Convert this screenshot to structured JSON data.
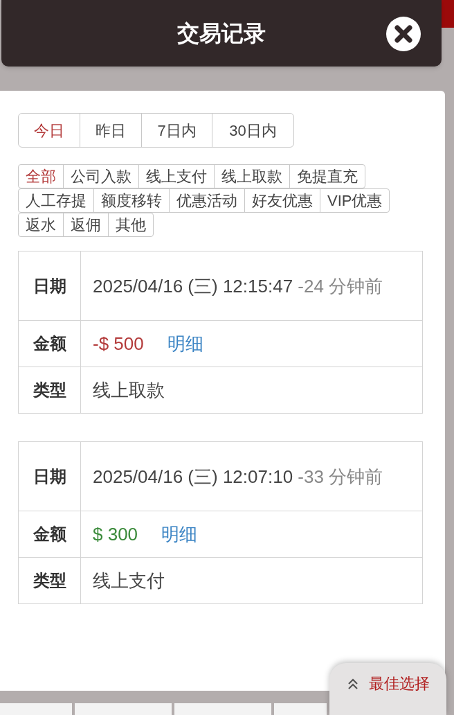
{
  "window": {
    "title": "交易记录"
  },
  "periods": [
    {
      "label": "今日",
      "selected": true
    },
    {
      "label": "昨日",
      "selected": false
    },
    {
      "label": "7日内",
      "selected": false
    },
    {
      "label": "30日内",
      "selected": false
    }
  ],
  "categories": [
    [
      {
        "label": "全部",
        "selected": true
      },
      {
        "label": "公司入款",
        "selected": false
      },
      {
        "label": "线上支付",
        "selected": false
      },
      {
        "label": "线上取款",
        "selected": false
      },
      {
        "label": "免提直充",
        "selected": false
      }
    ],
    [
      {
        "label": "人工存提",
        "selected": false
      },
      {
        "label": "额度移转",
        "selected": false
      },
      {
        "label": "优惠活动",
        "selected": false
      },
      {
        "label": "好友优惠",
        "selected": false
      },
      {
        "label": "VIP优惠",
        "selected": false
      }
    ],
    [
      {
        "label": "返水",
        "selected": false
      },
      {
        "label": "返佣",
        "selected": false
      },
      {
        "label": "其他",
        "selected": false
      }
    ]
  ],
  "records": [
    {
      "date_label": "日期",
      "date": "2025/04/16 (三) 12:15:47",
      "ago": "-24 分钟前",
      "amount_label": "金额",
      "amount": "-$ 500",
      "kind": "debit",
      "detail": "明细",
      "type_label": "类型",
      "type": "线上取款"
    },
    {
      "date_label": "日期",
      "date": "2025/04/16 (三) 12:07:10",
      "ago": "-33 分钟前",
      "amount_label": "金额",
      "amount": "$ 300",
      "kind": "credit",
      "detail": "明细",
      "type_label": "类型",
      "type": "线上支付"
    }
  ],
  "best_choice": "最佳选择"
}
